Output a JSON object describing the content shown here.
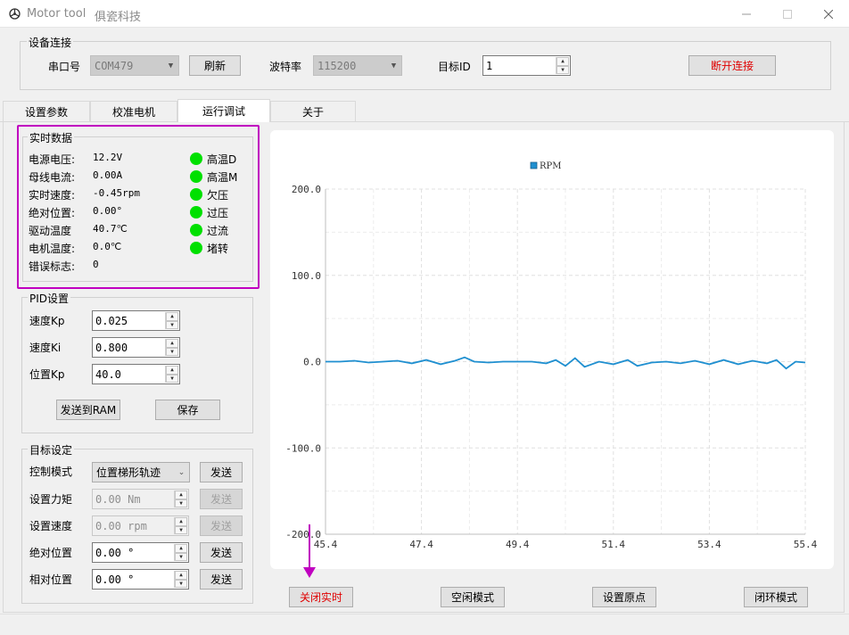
{
  "window": {
    "title": "Motor tool",
    "brand": "俱瓷科技"
  },
  "conn": {
    "group_title": "设备连接",
    "port_label": "串口号",
    "port_value": "COM479",
    "refresh_label": "刷新",
    "baud_label": "波特率",
    "baud_value": "115200",
    "target_label": "目标ID",
    "target_value": "1",
    "disconnect_label": "断开连接",
    "disconnect_color": "#e00000"
  },
  "tabs": [
    "设置参数",
    "校准电机",
    "运行调试",
    "关于"
  ],
  "realtime": {
    "title": "实时数据",
    "rows": [
      {
        "label": "电源电压:",
        "value": "12.2V"
      },
      {
        "label": "母线电流:",
        "value": "0.00A"
      },
      {
        "label": "实时速度:",
        "value": "-0.45rpm"
      },
      {
        "label": "绝对位置:",
        "value": "0.00°"
      },
      {
        "label": "驱动温度",
        "value": "40.7℃"
      },
      {
        "label": "电机温度:",
        "value": "0.0℃"
      },
      {
        "label": "错误标志:",
        "value": "0"
      }
    ],
    "leds": [
      "高温D",
      "高温M",
      "欠压",
      "过压",
      "过流",
      "堵转"
    ],
    "led_color": "#00e000",
    "highlight_color": "#c000c0"
  },
  "pid": {
    "title": "PID设置",
    "rows": [
      {
        "label": "速度Kp",
        "value": "0.025"
      },
      {
        "label": "速度Ki",
        "value": "0.800"
      },
      {
        "label": "位置Kp",
        "value": "40.0"
      }
    ],
    "send_ram_label": "发送到RAM",
    "save_label": "保存"
  },
  "target": {
    "title": "目标设定",
    "mode_label": "控制模式",
    "mode_value": "位置梯形轨迹",
    "rows": [
      {
        "label": "设置力矩",
        "value": "0.00 Nm",
        "disabled": true
      },
      {
        "label": "设置速度",
        "value": "0.00 rpm",
        "disabled": true
      },
      {
        "label": "绝对位置",
        "value": "0.00 °",
        "disabled": false
      },
      {
        "label": "相对位置",
        "value": "0.00 °",
        "disabled": false
      }
    ],
    "send_label": "发送"
  },
  "bottom_buttons": {
    "close_realtime": "关闭实时",
    "idle_mode": "空闲模式",
    "set_origin": "设置原点",
    "closed_loop": "闭环模式"
  },
  "chart_data": {
    "type": "line",
    "legend": [
      "RPM"
    ],
    "legend_placement": "top-center",
    "series_color": "#1f8fd0",
    "grid": true,
    "xlim": [
      45.4,
      55.4
    ],
    "ylim": [
      -200,
      200
    ],
    "x_ticks": [
      "45.4",
      "47.4",
      "49.4",
      "51.4",
      "53.4",
      "55.4"
    ],
    "y_ticks": [
      "200.0",
      "100.0",
      "0.0",
      "-100.0",
      "-200.0"
    ],
    "series": [
      {
        "name": "RPM",
        "x": [
          45.4,
          45.7,
          46.0,
          46.3,
          46.6,
          46.9,
          47.2,
          47.5,
          47.8,
          48.1,
          48.3,
          48.5,
          48.8,
          49.1,
          49.4,
          49.7,
          50.0,
          50.2,
          50.4,
          50.6,
          50.8,
          51.1,
          51.4,
          51.7,
          51.9,
          52.2,
          52.5,
          52.8,
          53.1,
          53.4,
          53.7,
          54.0,
          54.3,
          54.6,
          54.8,
          55.0,
          55.2,
          55.4
        ],
        "y": [
          0,
          0,
          1,
          -1,
          0,
          1,
          -2,
          2,
          -3,
          1,
          5,
          0,
          -1,
          0,
          0,
          0,
          -2,
          2,
          -5,
          4,
          -6,
          0,
          -3,
          2,
          -5,
          -1,
          0,
          -2,
          1,
          -3,
          2,
          -3,
          1,
          -2,
          2,
          -8,
          0,
          -1
        ]
      }
    ]
  }
}
